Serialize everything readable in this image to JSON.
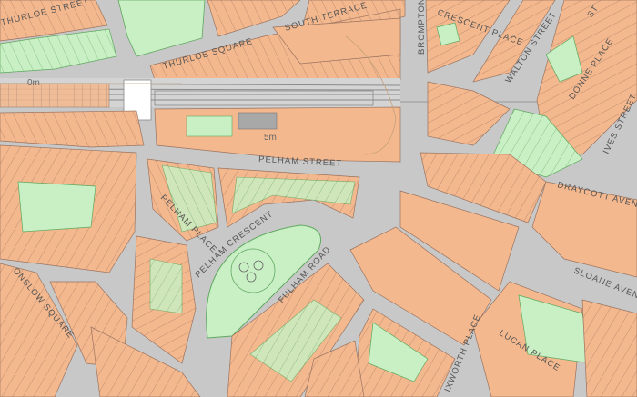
{
  "map": {
    "colors": {
      "background": "#c8c8c8",
      "building": "#f4b88e",
      "building_stroke": "#9b7460",
      "garden": "#c9efc4",
      "garden_stroke": "#5fa85f",
      "road": "#c8c8c8",
      "rail": "#8a8a8a"
    },
    "street_labels": {
      "thurloe_street": "THURLOE STREET",
      "south_terrace": "SOUTH TERRACE",
      "thurloe_square": "THURLOE SQUARE",
      "brompton_road": "BROMPTON R",
      "crescent_place": "CRESCENT PLACE",
      "walton_street": "WALTON STREET",
      "ixworth_st_short": "ST",
      "donne_place": "DONNE PLACE",
      "ives_street": "IVES STREET",
      "pelham_street": "PELHAM STREET",
      "draycott_avenue": "DRAYCOTT AVENUE",
      "pelham_place": "PELHAM PLACE",
      "pelham_crescent_1": "PELHAM",
      "pelham_crescent_2": "CRESCENT",
      "onslow_square": "ONSLOW SQUARE",
      "fulham_road": "FULHAM ROAD",
      "sloane_avenue": "SLOANE AVENUE",
      "ixworth_place": "IXWORTH PLACE",
      "lucan_place": "LUCAN PLACE"
    },
    "contour_labels": {
      "zero_m": "0m",
      "five_m": "5m"
    }
  }
}
